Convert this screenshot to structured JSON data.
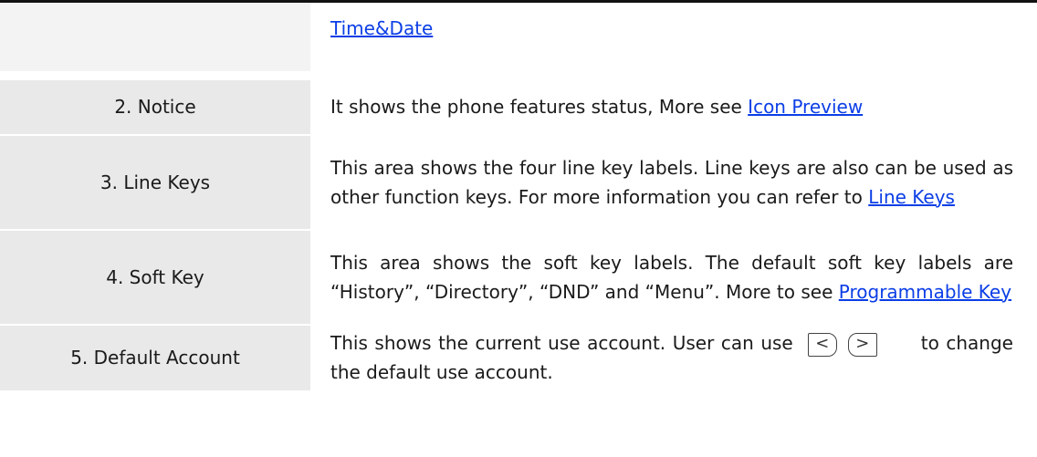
{
  "rows": [
    {
      "label": "",
      "pre": "",
      "link": "Time&Date",
      "post": ""
    },
    {
      "label": "2. Notice",
      "pre": "It shows the phone features status, More see ",
      "link": "Icon Preview",
      "post": ""
    },
    {
      "label": "3. Line Keys",
      "pre": "This area shows the four line key labels. Line keys are also can be used as other function keys. For more information you can refer to ",
      "link": "Line Keys",
      "post": ""
    },
    {
      "label": "4. Soft Key",
      "pre": "This area shows the soft key labels. The default soft key labels are “History”, “Directory”, “DND” and “Menu”. More to see ",
      "link": "Programmable Key",
      "post": ""
    },
    {
      "label": "5. Default Account",
      "pre": "This shows the current use account. User can use",
      "left_key": "<",
      "right_key": ">",
      "post": "to change the default use account."
    }
  ],
  "icons": {
    "left_key": "left-arrow-key-icon",
    "right_key": "right-arrow-key-icon"
  },
  "colors": {
    "link": "#0b3ee6",
    "label_bg": "#e9e9e9"
  }
}
